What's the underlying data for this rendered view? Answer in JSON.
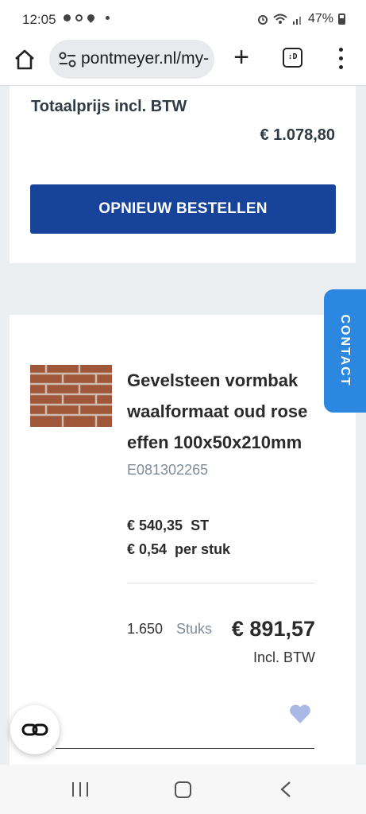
{
  "status_bar": {
    "time": "12:05",
    "battery": "47%",
    "icons": [
      "notification-dot-icon",
      "sync-icon",
      "location-icon",
      "alarm-icon",
      "wifi-icon",
      "signal-icon",
      "battery-icon"
    ]
  },
  "browser": {
    "url": "pontmeyer.nl/my-",
    "tab_label": ":D"
  },
  "order_summary": {
    "total_label": "Totaalprijs incl. BTW",
    "total_value": "€ 1.078,80",
    "reorder_button": "OPNIEUW BESTELLEN"
  },
  "product": {
    "name": "Gevelsteen vormbak waalformaat oud rose effen 100x50x210mm",
    "code": "E081302265",
    "price_unit": "€ 540,35  ST",
    "price_per_piece": "€ 0,54  per stuk",
    "quantity": "1.650",
    "quantity_unit": "Stuks",
    "line_total": "€ 891,57",
    "incl_btw": "Incl. BTW"
  },
  "contact_tab": "CONTACT",
  "colors": {
    "primary_blue": "#17449a",
    "contact_blue": "#2b87e0",
    "favorite_heart": "#a9b9e6",
    "code_gray": "#7f8c99"
  }
}
